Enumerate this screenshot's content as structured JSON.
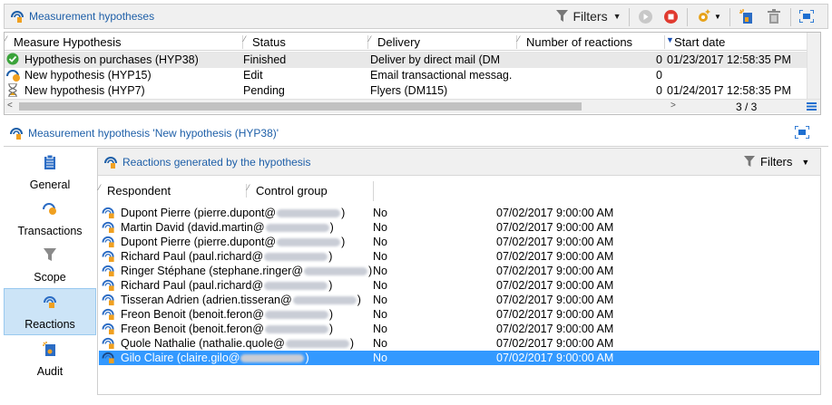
{
  "top_panel": {
    "title": "Measurement hypotheses",
    "filters_label": "Filters"
  },
  "hyp_grid": {
    "columns": [
      "Measure Hypothesis",
      "Status",
      "Delivery",
      "Number of reactions",
      "Start date"
    ],
    "rows": [
      {
        "name": "Hypothesis on purchases (HYP38)",
        "status": "Finished",
        "delivery": "Deliver by direct mail (DM",
        "reactions": "0",
        "start": "01/23/2017 12:58:35 PM",
        "icon": "check-icon"
      },
      {
        "name": "New hypothesis (HYP15)",
        "status": "Edit",
        "delivery": "Email transactional messag.",
        "reactions": "0",
        "start": "",
        "icon": "hypothesis-edit-icon"
      },
      {
        "name": "New hypothesis (HYP7)",
        "status": "Pending",
        "delivery": "Flyers (DM115)",
        "reactions": "0",
        "start": "01/24/2017 12:58:35 PM",
        "icon": "hourglass-icon"
      }
    ],
    "page_counter": "3 / 3"
  },
  "detail_panel": {
    "title": "Measurement hypothesis 'New hypothesis (HYP38)'"
  },
  "sidebar": {
    "items": [
      {
        "label": "General",
        "icon": "clipboard-icon"
      },
      {
        "label": "Transactions",
        "icon": "transactions-icon"
      },
      {
        "label": "Scope",
        "icon": "funnel-icon"
      },
      {
        "label": "Reactions",
        "icon": "reactions-icon"
      },
      {
        "label": "Audit",
        "icon": "audit-icon"
      }
    ],
    "active": "Reactions"
  },
  "reactions": {
    "title": "Reactions generated by the hypothesis",
    "filters_label": "Filters",
    "columns": [
      "Respondent",
      "Control group"
    ],
    "rows": [
      {
        "respondent": "Dupont Pierre (pierre.dupont@",
        "close": ")",
        "control": "No",
        "date": "07/02/2017 9:00:00 AM"
      },
      {
        "respondent": "Martin David (david.martin@",
        "close": ")",
        "control": "No",
        "date": "07/02/2017 9:00:00 AM"
      },
      {
        "respondent": "Dupont Pierre (pierre.dupont@",
        "close": ")",
        "control": "No",
        "date": "07/02/2017 9:00:00 AM"
      },
      {
        "respondent": "Richard Paul (paul.richard@",
        "close": ")",
        "control": "No",
        "date": "07/02/2017 9:00:00 AM"
      },
      {
        "respondent": "Ringer Stéphane (stephane.ringer@",
        "close": ")",
        "control": "No",
        "date": "07/02/2017 9:00:00 AM"
      },
      {
        "respondent": "Richard Paul (paul.richard@",
        "close": ")",
        "control": "No",
        "date": "07/02/2017 9:00:00 AM"
      },
      {
        "respondent": "Tisseran Adrien (adrien.tisseran@",
        "close": ")",
        "control": "No",
        "date": "07/02/2017 9:00:00 AM"
      },
      {
        "respondent": "Freon Benoit (benoit.feron@",
        "close": ")",
        "control": "No",
        "date": "07/02/2017 9:00:00 AM"
      },
      {
        "respondent": "Freon Benoit (benoit.feron@",
        "close": ")",
        "control": "No",
        "date": "07/02/2017 9:00:00 AM"
      },
      {
        "respondent": "Quole Nathalie (nathalie.quole@",
        "close": ")",
        "control": "No",
        "date": "07/02/2017 9:00:00 AM"
      },
      {
        "respondent": "Gilo Claire (claire.gilo@",
        "close": ")",
        "control": "No",
        "date": "07/02/2017 9:00:00 AM"
      }
    ],
    "selected_row": 10
  },
  "colors": {
    "accent": "#1e5fa8",
    "selection": "#3399ff",
    "sidebar_active": "#cce4f7",
    "stop_red": "#e03a2f",
    "check_green": "#3aa33a"
  }
}
